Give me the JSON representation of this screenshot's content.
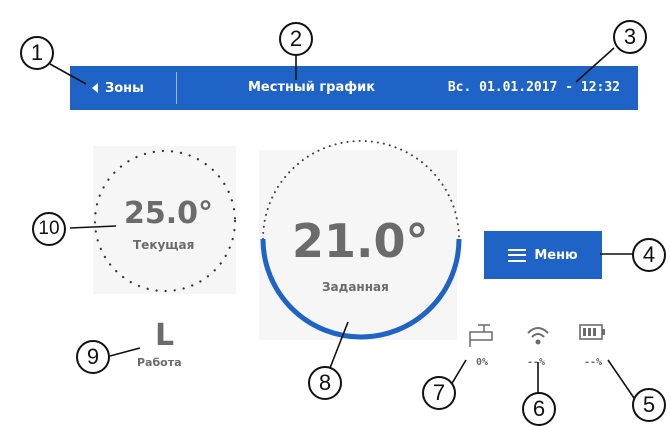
{
  "header": {
    "back_label": "Зоны",
    "title": "Местный график",
    "datetime": "Вс. 01.01.2017 - 12:32"
  },
  "current": {
    "value": "25.0°",
    "label": "Текущая"
  },
  "target": {
    "value": "21.0°",
    "label": "Заданная",
    "arc_color": "#1f63c7"
  },
  "menu": {
    "label": "Меню"
  },
  "mode": {
    "letter": "L",
    "label": "Работа"
  },
  "status": {
    "valve": {
      "icon": "valve-icon",
      "value": "0%"
    },
    "signal": {
      "icon": "wifi-icon",
      "value": "--%"
    },
    "battery": {
      "icon": "battery-icon",
      "value": "--%"
    }
  },
  "callouts": [
    "1",
    "2",
    "3",
    "4",
    "5",
    "6",
    "7",
    "8",
    "9",
    "10"
  ],
  "colors": {
    "accent": "#1f63c7",
    "text": "#6b6b6b"
  }
}
